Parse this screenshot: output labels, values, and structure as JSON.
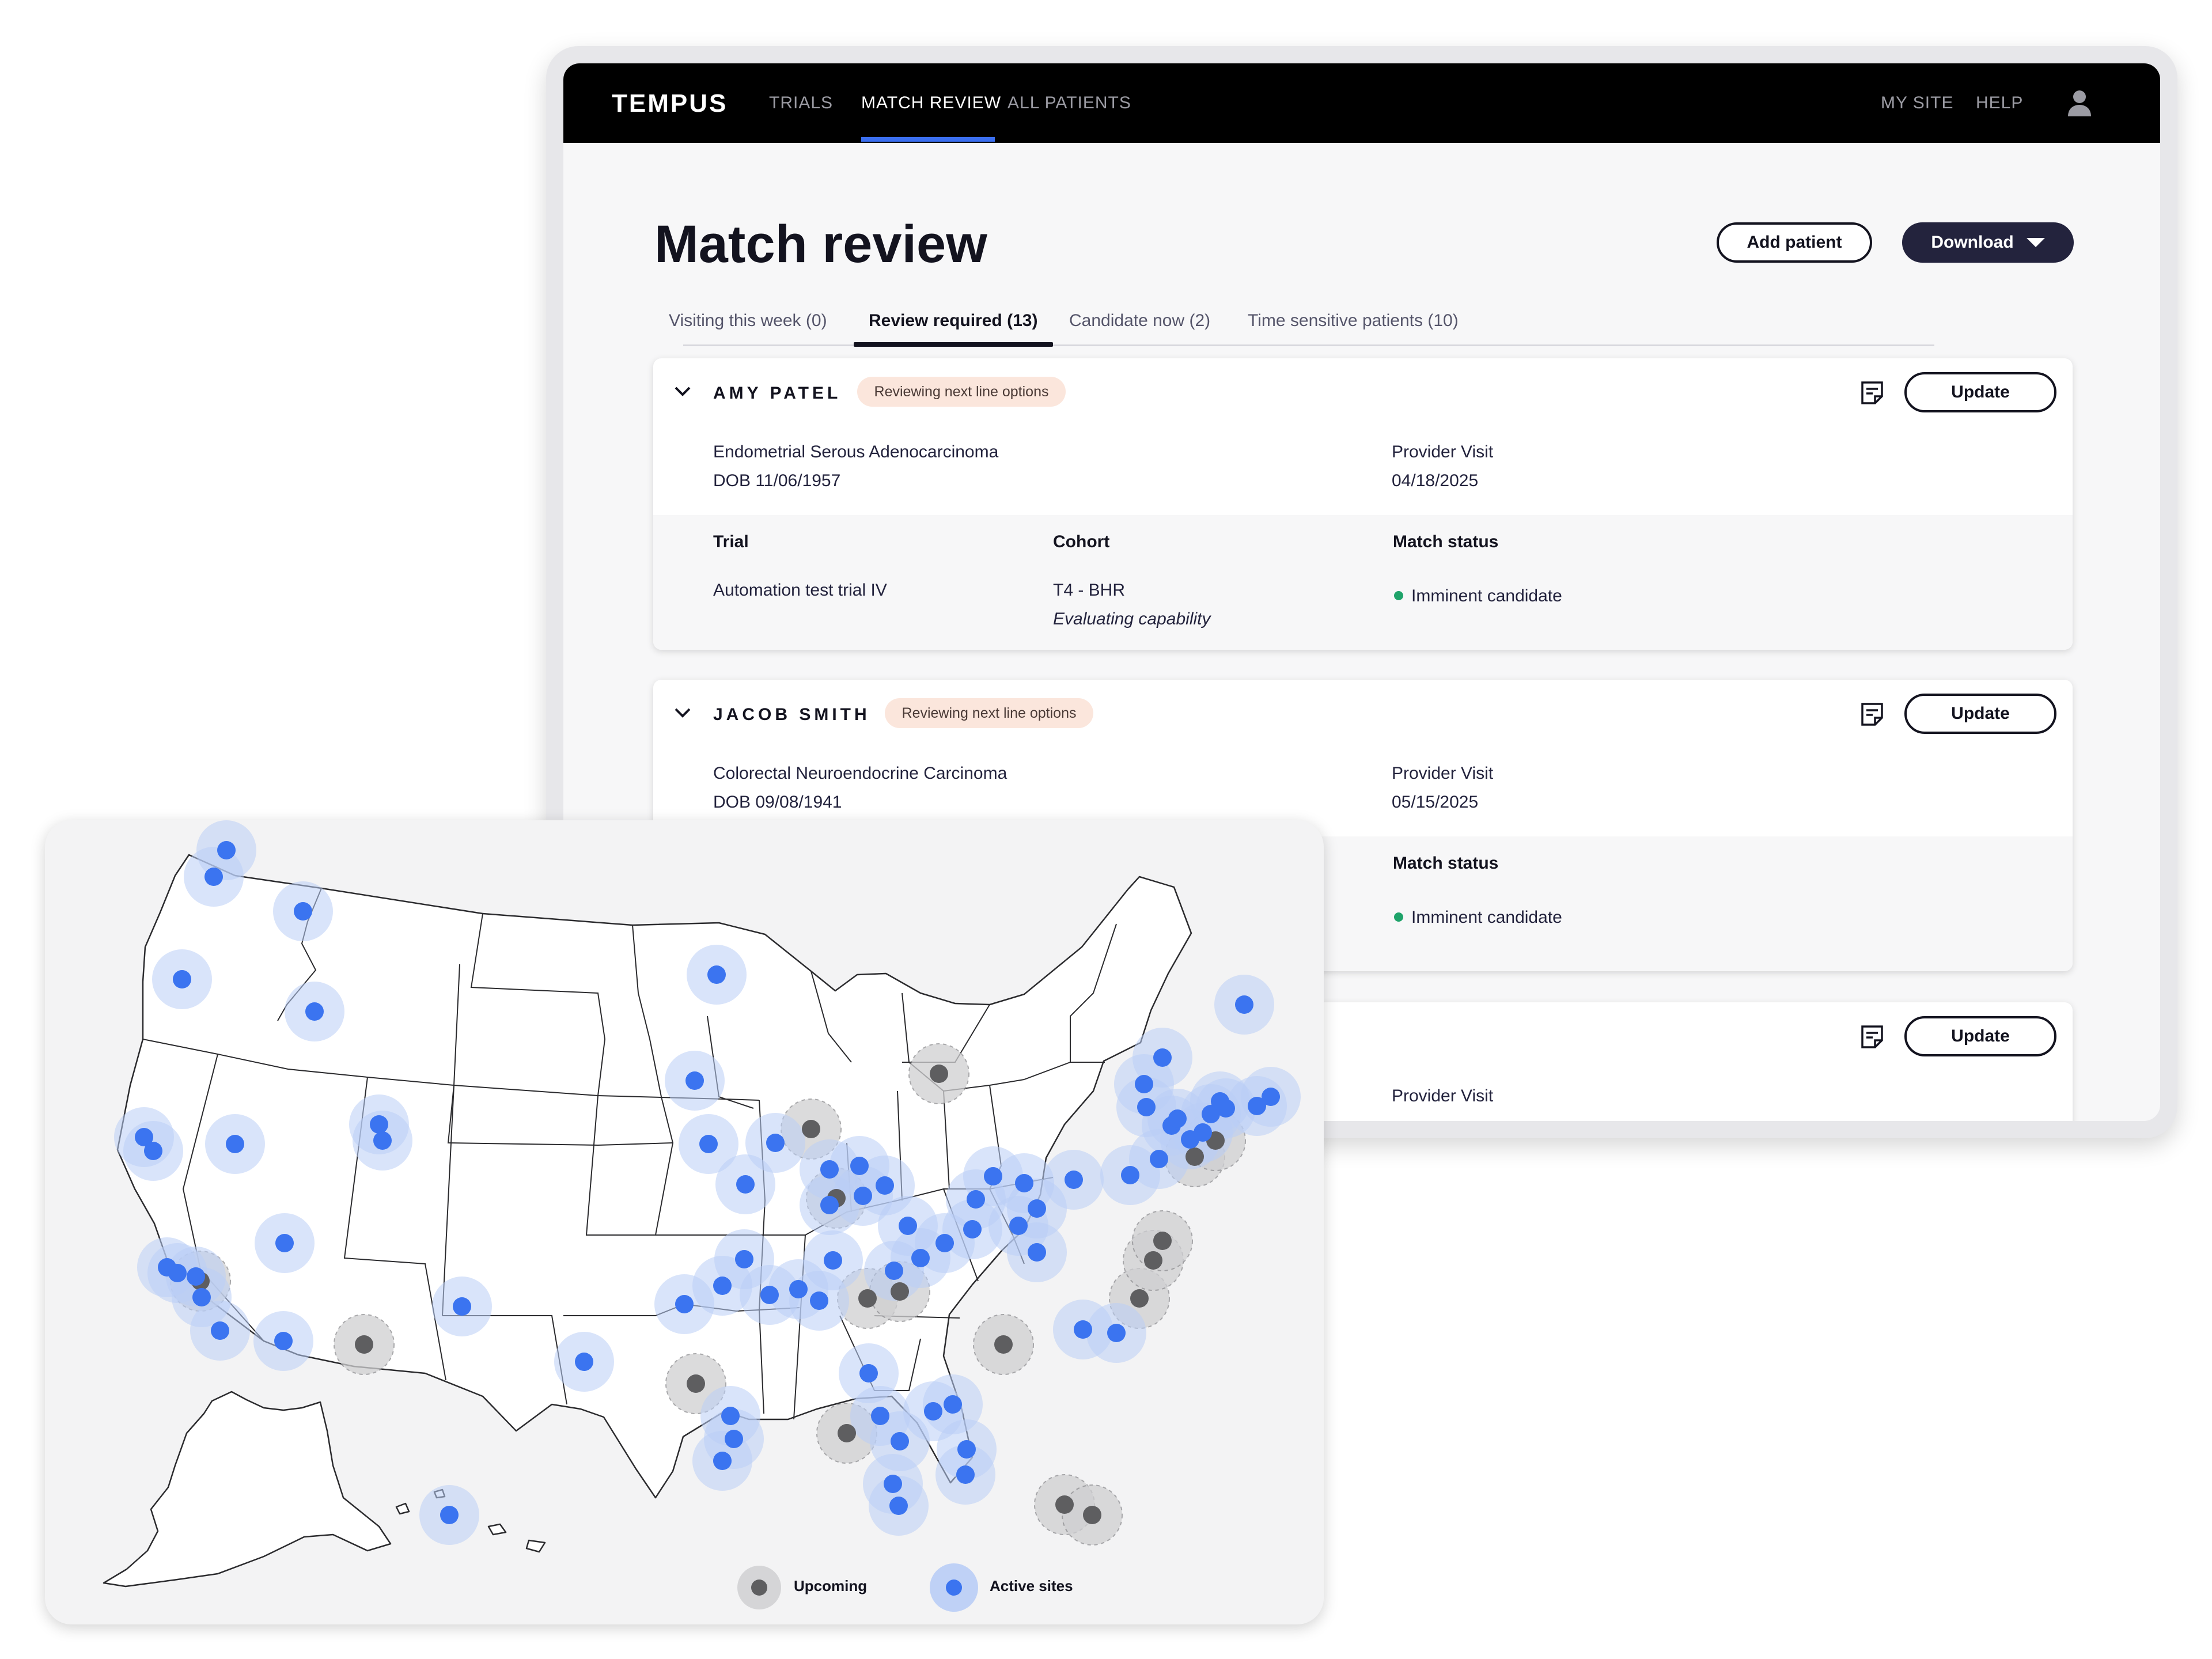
{
  "nav": {
    "logo": "TEMPUS",
    "links": [
      "TRIALS",
      "MATCH REVIEW",
      "ALL PATIENTS"
    ],
    "active_link": "MATCH REVIEW",
    "right_links": [
      "MY SITE",
      "HELP"
    ],
    "user_icon": "user-icon"
  },
  "page": {
    "title": "Match review",
    "add_patient": "Add patient",
    "download": "Download"
  },
  "tabs": [
    {
      "label": "Visiting this week (0)"
    },
    {
      "label": "Review required (13)",
      "active": true
    },
    {
      "label": "Candidate now (2)"
    },
    {
      "label": "Time sensitive patients (10)"
    }
  ],
  "patients": [
    {
      "name": "AMY PATEL",
      "status_badge": "Reviewing next line options",
      "diagnosis": "Endometrial Serous Adenocarcinoma",
      "dob": "DOB 11/06/1957",
      "visit_label": "Provider Visit",
      "visit_date": "04/18/2025",
      "update": "Update",
      "table_headers": [
        "Trial",
        "Cohort",
        "Match status"
      ],
      "trial": "Automation test trial IV",
      "cohort": "T4 - BHR",
      "cohort_note": "Evaluating capability",
      "match_status": "Imminent candidate"
    },
    {
      "name": "JACOB SMITH",
      "status_badge": "Reviewing next line options",
      "diagnosis": "Colorectal Neuroendocrine Carcinoma",
      "dob": "DOB 09/08/1941",
      "visit_label": "Provider Visit",
      "visit_date": "05/15/2025",
      "update": "Update",
      "match_status_header": "Match status",
      "match_status": "Imminent candidate"
    },
    {
      "update": "Update",
      "visit_label": "Provider Visit"
    }
  ],
  "map": {
    "legend": {
      "upcoming": "Upcoming",
      "active": "Active sites"
    },
    "colors": {
      "active": "#3b74f0",
      "active_halo": "#b9cdf6",
      "upcoming": "#5e5e60",
      "upcoming_halo": "#cfcfd1"
    },
    "active_site_count": 78,
    "upcoming_site_count": 17
  }
}
